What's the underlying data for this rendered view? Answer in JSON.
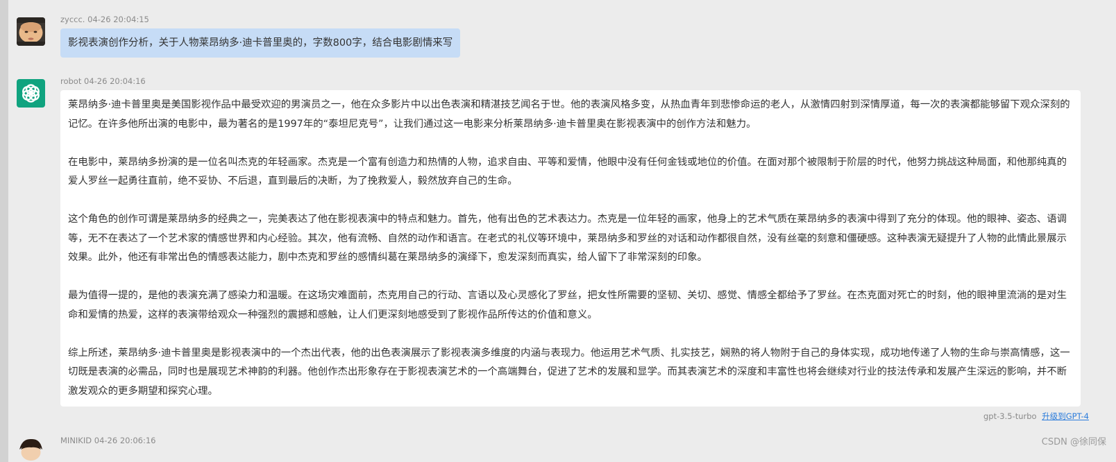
{
  "messages": [
    {
      "author": "zyccc.",
      "time": "04-26 20:04:15",
      "avatar_icon": "user-photo-avatar",
      "text": "影视表演创作分析，关于人物莱昂纳多·迪卡普里奥的，字数800字，结合电影剧情来写"
    },
    {
      "author": "robot",
      "time": "04-26 20:04:16",
      "avatar_icon": "openai-logo-icon",
      "paragraphs": [
        "莱昂纳多·迪卡普里奥是美国影视作品中最受欢迎的男演员之一，他在众多影片中以出色表演和精湛技艺闻名于世。他的表演风格多变，从热血青年到悲惨命运的老人，从激情四射到深情厚道，每一次的表演都能够留下观众深刻的记忆。在许多他所出演的电影中，最为著名的是1997年的“泰坦尼克号”，让我们通过这一电影来分析莱昂纳多·迪卡普里奥在影视表演中的创作方法和魅力。",
        "在电影中，莱昂纳多扮演的是一位名叫杰克的年轻画家。杰克是一个富有创造力和热情的人物，追求自由、平等和爱情，他眼中没有任何金钱或地位的价值。在面对那个被限制于阶层的时代，他努力挑战这种局面，和他那纯真的爱人罗丝一起勇往直前，绝不妥协、不后退，直到最后的决断，为了挽救爱人，毅然放弃自己的生命。",
        "这个角色的创作可谓是莱昂纳多的经典之一，完美表达了他在影视表演中的特点和魅力。首先，他有出色的艺术表达力。杰克是一位年轻的画家，他身上的艺术气质在莱昂纳多的表演中得到了充分的体现。他的眼神、姿态、语调等，无不在表达了一个艺术家的情感世界和内心经验。其次，他有流畅、自然的动作和语言。在老式的礼仪等环境中，莱昂纳多和罗丝的对话和动作都很自然，没有丝毫的刻意和僵硬感。这种表演无疑提升了人物的此情此景展示效果。此外，他还有非常出色的情感表达能力，剧中杰克和罗丝的感情纠葛在莱昂纳多的演绎下，愈发深刻而真实，给人留下了非常深刻的印象。",
        "最为值得一提的，是他的表演充满了感染力和温暖。在这场灾难面前，杰克用自己的行动、言语以及心灵感化了罗丝，把女性所需要的坚韧、关切、感觉、情感全都给予了罗丝。在杰克面对死亡的时刻，他的眼神里流淌的是对生命和爱情的热爱，这样的表演带给观众一种强烈的震撼和感触，让人们更深刻地感受到了影视作品所传达的价值和意义。",
        "综上所述，莱昂纳多·迪卡普里奥是影视表演中的一个杰出代表，他的出色表演展示了影视表演多维度的内涵与表现力。他运用艺术气质、扎实技艺，娴熟的将人物附于自己的身体实现，成功地传递了人物的生命与崇高情感，这一切既是表演的必需品，同时也是展现艺术神韵的利器。他创作杰出形象存在于影视表演艺术的一个高端舞台，促进了艺术的发展和显学。而其表演艺术的深度和丰富性也将会继续对行业的技法传承和发展产生深远的影响，并不断激发观众的更多期望和探究心理。"
      ],
      "model": "gpt-3.5-turbo",
      "upgrade_link": "升级到GPT-4"
    },
    {
      "author": "MINIKID",
      "time": "04-26 20:06:16",
      "avatar_icon": "user-cartoon-avatar"
    }
  ],
  "watermark": "CSDN @徐同保",
  "colors": {
    "page_bg": "#ececec",
    "user_bubble": "#c6dcf6",
    "bot_bubble": "#ffffff",
    "bot_avatar": "#10a37f",
    "link": "#2a7bdb"
  }
}
